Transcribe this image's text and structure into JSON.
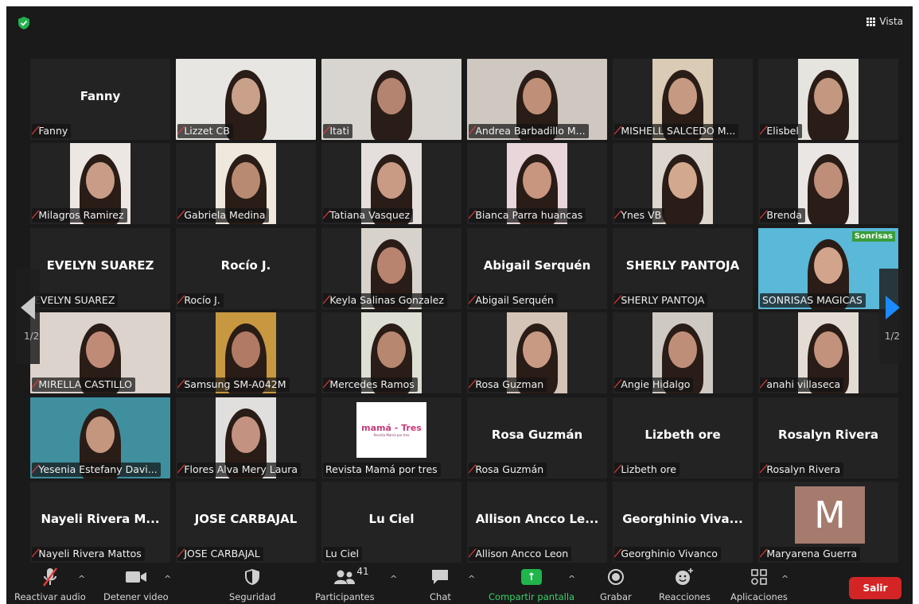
{
  "topbar": {
    "view_label": "Vista",
    "security_icon": "shield-check-icon"
  },
  "pagination": {
    "left_page": "1/2",
    "right_page": "1/2"
  },
  "tiles": [
    {
      "name": "Fanny",
      "big": "Fanny",
      "muted": true
    },
    {
      "name": "Lizzet CB",
      "video": true,
      "muted": true,
      "skin": "#c9a08a",
      "bg": "#e8e6e2"
    },
    {
      "name": "Itati",
      "video": true,
      "muted": true,
      "skin": "#b48470",
      "bg": "#d8d4cf"
    },
    {
      "name": "Andrea Barbadillo M...",
      "video": true,
      "muted": true,
      "skin": "#bf8f78",
      "bg": "#cfc8c0"
    },
    {
      "name": "MISHELL SALCEDO M...",
      "video": true,
      "muted": true,
      "skin": "#c69a82",
      "bg": "#d9cbb5",
      "narrow": true
    },
    {
      "name": "Elisbel",
      "video": true,
      "muted": true,
      "skin": "#c39780",
      "bg": "#e6e4df",
      "narrow": true
    },
    {
      "name": "Milagros Ramirez",
      "video": true,
      "muted": true,
      "skin": "#c89c86",
      "bg": "#ede7e4",
      "narrow": true
    },
    {
      "name": "Gabriela Medina",
      "video": true,
      "muted": true,
      "skin": "#b98a72",
      "bg": "#efe8dc",
      "narrow": true
    },
    {
      "name": "Tatiana Vasquez",
      "video": true,
      "muted": true,
      "skin": "#c99a84",
      "bg": "#e4dfdc",
      "narrow": true
    },
    {
      "name": "Bianca Parra huancas",
      "video": true,
      "muted": true,
      "skin": "#c8957f",
      "bg": "#e8d6da",
      "narrow": true
    },
    {
      "name": "Ynes VB",
      "video": true,
      "muted": true,
      "skin": "#d2a88f",
      "bg": "#dcd6ce",
      "narrow": true
    },
    {
      "name": "Brenda",
      "video": true,
      "muted": true,
      "skin": "#bf8e78",
      "bg": "#e9e6e3",
      "narrow": true
    },
    {
      "name": "EVELYN SUAREZ",
      "big": "EVELYN SUAREZ",
      "muted": false
    },
    {
      "name": "Rocío  J.",
      "big": "Rocío  J.",
      "muted": true
    },
    {
      "name": "Keyla Salinas Gonzalez",
      "video": true,
      "muted": true,
      "skin": "#b88470",
      "bg": "#d8d2cc",
      "narrow": true
    },
    {
      "name": "Abigail Serquén",
      "big": "Abigail Serquén",
      "muted": true
    },
    {
      "name": "SHERLY PANTOJA",
      "big": "SHERLY PANTOJA",
      "muted": true
    },
    {
      "name": "SONRISAS MAGICAS",
      "video": true,
      "muted": false,
      "speaking": true,
      "skin": "#d2a48c",
      "bg": "#5ab8d8",
      "caption": "Sonrisas"
    },
    {
      "name": "MIRELLA CASTILLO",
      "video": true,
      "muted": true,
      "skin": "#c08b76",
      "bg": "#dcd3cd"
    },
    {
      "name": "Samsung SM-A042M",
      "video": true,
      "muted": true,
      "skin": "#b07a64",
      "bg": "#c89840",
      "narrow": true
    },
    {
      "name": "Mercedes Ramos",
      "video": true,
      "muted": true,
      "skin": "#b7876f",
      "bg": "#dedfd4",
      "narrow": true
    },
    {
      "name": "Rosa Guzman",
      "video": true,
      "muted": true,
      "skin": "#c89a84",
      "bg": "#d4c4b8",
      "narrow": true
    },
    {
      "name": "Angie Hidalgo",
      "video": true,
      "muted": true,
      "skin": "#bf8e78",
      "bg": "#cfc9c4",
      "narrow": true
    },
    {
      "name": "anahi villaseca",
      "video": true,
      "muted": true,
      "skin": "#c2927c",
      "bg": "#e3dcd5",
      "narrow": true
    },
    {
      "name": "Yesenia Estefany Davi...",
      "video": true,
      "muted": true,
      "skin": "#c5967e",
      "bg": "#3f8f9f"
    },
    {
      "name": "Flores Alva Mery Laura",
      "video": true,
      "muted": true,
      "skin": "#c39280",
      "bg": "#e1dede",
      "narrow": true
    },
    {
      "name": "Revista Mamá por tres",
      "logo": "mamá - Tres",
      "logo_sub": "Revista Mamá por tres",
      "muted": false
    },
    {
      "name": "Rosa Guzmán",
      "big": "Rosa Guzmán",
      "muted": true
    },
    {
      "name": "Lizbeth ore",
      "big": "Lizbeth ore",
      "muted": true
    },
    {
      "name": "Rosalyn Rivera",
      "big": "Rosalyn Rivera",
      "muted": true
    },
    {
      "name": "Nayeli Rivera Mattos",
      "big": "Nayeli Rivera M...",
      "muted": true
    },
    {
      "name": "JOSE CARBAJAL",
      "big": "JOSE CARBAJAL",
      "muted": true
    },
    {
      "name": "Lu Ciel",
      "big": "Lu Ciel",
      "muted": false
    },
    {
      "name": "Allison Ancco Leon",
      "big": "Allison Ancco Le...",
      "muted": true
    },
    {
      "name": "Georghinio Vivanco",
      "big": "Georghinio  Viva...",
      "muted": true
    },
    {
      "name": "Maryarena Guerra",
      "avatar": "M",
      "muted": true
    }
  ],
  "toolbar": {
    "audio": "Reactivar audio",
    "video": "Detener video",
    "security": "Seguridad",
    "participants": "Participantes",
    "participants_count": "41",
    "chat": "Chat",
    "share": "Compartir pantalla",
    "record": "Grabar",
    "reactions": "Reacciones",
    "apps": "Aplicaciones",
    "leave": "Salir"
  },
  "colors": {
    "leave": "#d32525",
    "share": "#1fb54a",
    "mute": "#e33b3b",
    "speaking_border": "#f1e24b",
    "arrow_active": "#1a8bff"
  }
}
